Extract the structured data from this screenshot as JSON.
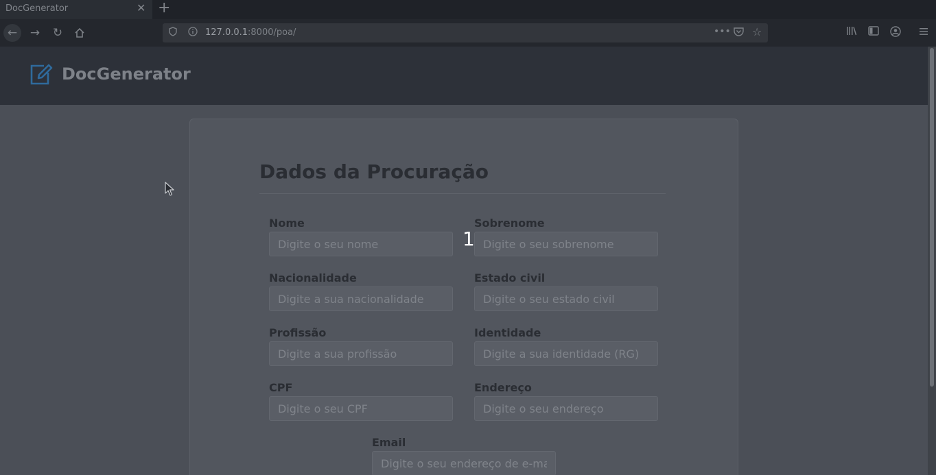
{
  "browser": {
    "tab_title": "DocGenerator",
    "tab_close": "✕",
    "new_tab": "+",
    "url_host": "127.0.0.1",
    "url_path": ":8000/poa/",
    "page_actions": "•••"
  },
  "app": {
    "brand": "DocGenerator"
  },
  "form": {
    "title": "Dados da Procuração",
    "fields": [
      {
        "label": "Nome",
        "placeholder": "Digite o seu nome",
        "value": ""
      },
      {
        "label": "Sobrenome",
        "placeholder": "Digite o seu sobrenome",
        "value": ""
      },
      {
        "label": "Nacionalidade",
        "placeholder": "Digite a sua nacionalidade",
        "value": ""
      },
      {
        "label": "Estado civil",
        "placeholder": "Digite o seu estado civil",
        "value": ""
      },
      {
        "label": "Profissão",
        "placeholder": "Digite a sua profissão",
        "value": ""
      },
      {
        "label": "Identidade",
        "placeholder": "Digite a sua identidade (RG)",
        "value": ""
      },
      {
        "label": "CPF",
        "placeholder": "Digite o seu CPF",
        "value": ""
      },
      {
        "label": "Endereço",
        "placeholder": "Digite o seu endereço",
        "value": ""
      },
      {
        "label": "Email",
        "placeholder": "Digite o seu endereço de e-mail",
        "value": ""
      }
    ]
  },
  "overlay": {
    "step_number": "1"
  }
}
